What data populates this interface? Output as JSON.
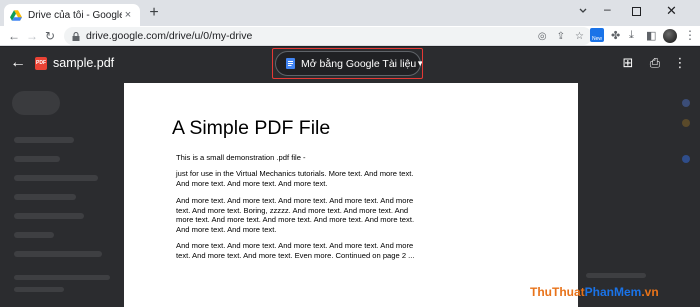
{
  "browser": {
    "tab": {
      "title": "Drive của tôi - Google Drive",
      "close": "×"
    },
    "new_tab": "+",
    "window": {
      "minimize": "–",
      "close": "✕"
    },
    "address": {
      "url": "drive.google.com/drive/u/0/my-drive"
    },
    "extension_badge": "New"
  },
  "viewer": {
    "back": "←",
    "file_badge": "PDF",
    "file_name": "sample.pdf",
    "open_with": {
      "label": "Mở bằng Google Tài liệu",
      "caret": "▼"
    },
    "actions": {
      "add_comment": "⊞",
      "print": "⎙",
      "more": "⋮"
    }
  },
  "pdf": {
    "title": "A Simple PDF File",
    "paragraphs": [
      "This is a small demonstration .pdf file -",
      "just for use in the Virtual Mechanics tutorials. More text. And more text. And more text. And more text. And more text.",
      "And more text. And more text. And more text. And more text. And more text. And more text. Boring, zzzzz. And more text. And more text. And more text. And more text. And more text. And more text. And more text. And more text. And more text.",
      "And more text. And more text. And more text. And more text. And more text. And more text. And more text. Even more. Continued on page 2 ..."
    ]
  },
  "watermark": {
    "part1": "ThuThuat",
    "part2": "PhanMem",
    "part3": ".vn"
  },
  "colors": {
    "highlight": "#e53935",
    "accent": "#1a73e8",
    "pdf_red": "#ea4335"
  }
}
